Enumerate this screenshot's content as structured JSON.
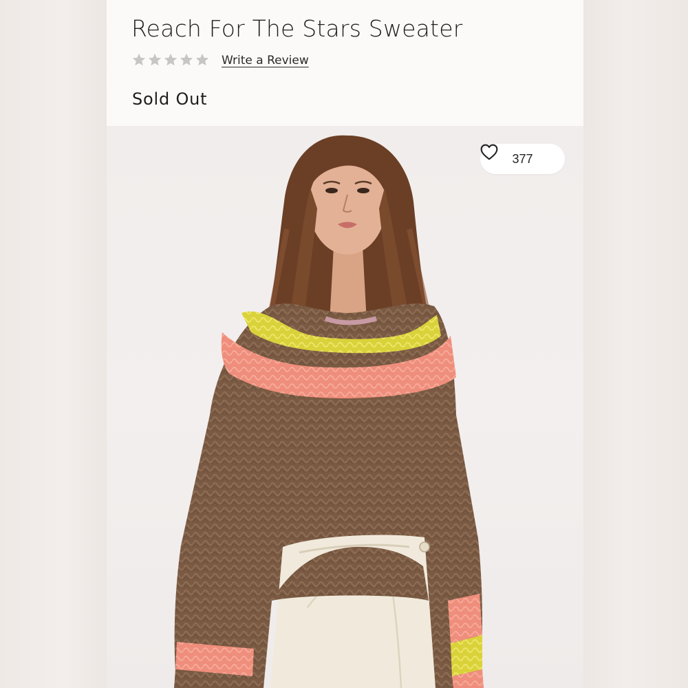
{
  "product": {
    "title": "Reach For The Stars Sweater",
    "rating_stars": 5,
    "rating_filled": 0,
    "review_link_label": "Write a Review",
    "availability": "Sold Out"
  },
  "favorites": {
    "count": "377",
    "icon": "heart-outline-icon"
  },
  "image": {
    "subject": "model wearing striped knit sweater"
  },
  "colors": {
    "star_empty": "#c8c6c4",
    "sweater_brown": "#7a5a43",
    "stripe_pink": "#ef8e7c",
    "stripe_yellow": "#d9d23a",
    "skirt_cream": "#f1eadc"
  }
}
